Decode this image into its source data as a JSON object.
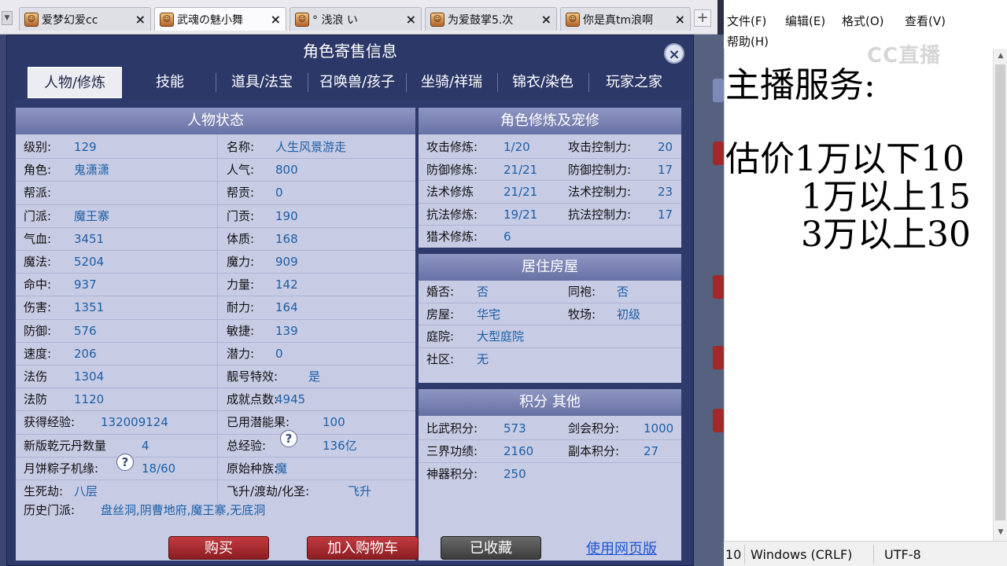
{
  "browser": {
    "tabs": [
      {
        "title": "爱梦幻爱cc",
        "active": false
      },
      {
        "title": "武魂の魅小舞",
        "active": true
      },
      {
        "title": "° 浅浪 い",
        "active": false
      },
      {
        "title": "为爱鼓掌5.次",
        "active": false
      },
      {
        "title": "你是真tm浪啊",
        "active": false
      }
    ],
    "new_tab": "+",
    "tab_close": "×"
  },
  "dialog": {
    "title": "角色寄售信息",
    "close": "×",
    "tabs": [
      "人物/修炼",
      "技能",
      "道具/法宝",
      "召唤兽/孩子",
      "坐骑/祥瑞",
      "锦衣/染色",
      "玩家之家"
    ]
  },
  "status_panel": {
    "title": "人物状态",
    "rows": [
      {
        "l1": "级别:",
        "v1": "129",
        "l2": "名称:",
        "v2": "人生风景游走"
      },
      {
        "l1": "角色:",
        "v1": "鬼潇潇",
        "l2": "人气:",
        "v2": "800"
      },
      {
        "l1": "帮派:",
        "v1": "",
        "l2": "帮贡:",
        "v2": "0"
      },
      {
        "l1": "门派:",
        "v1": "魔王寨",
        "l2": "门贡:",
        "v2": "190"
      },
      {
        "l1": "气血:",
        "v1": "3451",
        "l2": "体质:",
        "v2": "168"
      },
      {
        "l1": "魔法:",
        "v1": "5204",
        "l2": "魔力:",
        "v2": "909"
      },
      {
        "l1": "命中:",
        "v1": "937",
        "l2": "力量:",
        "v2": "142"
      },
      {
        "l1": "伤害:",
        "v1": "1351",
        "l2": "耐力:",
        "v2": "164"
      },
      {
        "l1": "防御:",
        "v1": "576",
        "l2": "敏捷:",
        "v2": "139"
      },
      {
        "l1": "速度:",
        "v1": "206",
        "l2": "潜力:",
        "v2": "0"
      },
      {
        "l1": "法伤",
        "v1": "1304",
        "l2": "靓号特效:",
        "v2": "是"
      },
      {
        "l1": "法防",
        "v1": "1120",
        "l2": "成就点数:",
        "v2": "4945"
      },
      {
        "l1": "获得经验:",
        "v1": "132009124",
        "l2": "已用潜能果:",
        "v2": "100"
      },
      {
        "l1": "新版乾元丹数量",
        "v1": "4",
        "l2": "总经验:",
        "v2": "136亿"
      },
      {
        "l1": "月饼粽子机缘:",
        "v1": "18/60",
        "l2": "原始种族:",
        "v2": "魔"
      },
      {
        "l1": "生死劫:",
        "v1": "八层",
        "l2": "飞升/渡劫/化圣:",
        "v2": "飞升"
      }
    ],
    "history_label": "历史门派:",
    "history_value": "盘丝洞,阴曹地府,魔王寨,无底洞",
    "help_icon": "?"
  },
  "cultivation_panel": {
    "title": "角色修炼及宠修",
    "rows": [
      {
        "l1": "攻击修炼:",
        "v1": "1/20",
        "l2": "攻击控制力:",
        "v2": "20"
      },
      {
        "l1": "防御修炼:",
        "v1": "21/21",
        "l2": "防御控制力:",
        "v2": "17"
      },
      {
        "l1": "法术修炼",
        "v1": "21/21",
        "l2": "法术控制力:",
        "v2": "23"
      },
      {
        "l1": "抗法修炼:",
        "v1": "19/21",
        "l2": "抗法控制力:",
        "v2": "17"
      },
      {
        "l1": "猎术修炼:",
        "v1": "6",
        "l2": "",
        "v2": ""
      }
    ]
  },
  "house_panel": {
    "title": "居住房屋",
    "rows": [
      {
        "l1": "婚否:",
        "v1": "否",
        "l2": "同袍:",
        "v2": "否"
      },
      {
        "l1": "房屋:",
        "v1": "华宅",
        "l2": "牧场:",
        "v2": "初级"
      },
      {
        "l1": "庭院:",
        "v1": "大型庭院",
        "l2": "",
        "v2": ""
      },
      {
        "l1": "社区:",
        "v1": "无",
        "l2": "",
        "v2": ""
      }
    ]
  },
  "points_panel": {
    "title": "积分 其他",
    "rows": [
      {
        "l1": "比武积分:",
        "v1": "573",
        "l2": "剑会积分:",
        "v2": "1000"
      },
      {
        "l1": "三界功绩:",
        "v1": "2160",
        "l2": "副本积分:",
        "v2": "27"
      },
      {
        "l1": "神器积分:",
        "v1": "250",
        "l2": "",
        "v2": ""
      }
    ]
  },
  "actions": {
    "buy": "购买",
    "add_cart": "加入购物车",
    "collected": "已收藏",
    "web_version": "使用网页版"
  },
  "notepad": {
    "menu": [
      "文件(F)",
      "编辑(E)",
      "格式(O)",
      "查看(V)",
      "帮助(H)"
    ],
    "watermark": "CC直播",
    "lines": [
      "主播服务:",
      "",
      "估价1万以下10",
      "1万以上15",
      "3万以上30"
    ],
    "status": {
      "pos": "10",
      "eol": "Windows (CRLF)",
      "enc": "UTF-8"
    }
  },
  "colors": {
    "accent": "#1b5fa6",
    "panel": "#c7cbe4",
    "panel_head": "#7880b2",
    "button_red": "#a82a30"
  }
}
